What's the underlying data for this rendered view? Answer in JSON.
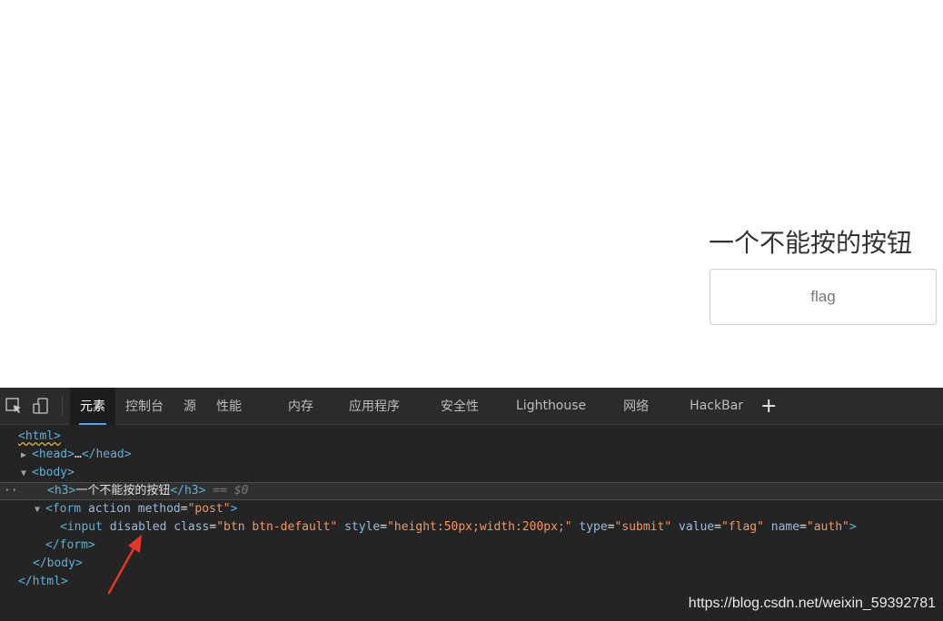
{
  "page": {
    "heading": "一个不能按的按钮",
    "button_value": "flag"
  },
  "devtools": {
    "tabs": [
      "元素",
      "控制台",
      "源",
      "性能",
      "内存",
      "应用程序",
      "安全性",
      "Lighthouse",
      "网络",
      "HackBar"
    ],
    "active_tab": "元素",
    "add_tab": "+",
    "tree": {
      "html_open": "<html>",
      "head_open": "<head>",
      "head_ellipsis": "…",
      "head_close": "</head>",
      "body_open": "<body>",
      "h3_open": "<h3>",
      "h3_text": "一个不能按的按钮",
      "h3_close": "</h3>",
      "selected_marker": "== $0",
      "form_open_tag": "<form",
      "form_attr_action": "action",
      "form_attr_method": "method",
      "form_method_value": "\"post\"",
      "input_open_tag": "<input",
      "input_attr_disabled": "disabled",
      "input_attr_class": "class",
      "input_class_value": "\"btn btn-default\"",
      "input_attr_style": "style",
      "input_style_value": "\"height:50px;width:200px;\"",
      "input_attr_type": "type",
      "input_type_value": "\"submit\"",
      "input_attr_value": "value",
      "input_value_value": "\"flag\"",
      "input_attr_name": "name",
      "input_name_value": "\"auth\"",
      "form_close": "</form>",
      "body_close": "</body>",
      "html_close": "</html>"
    }
  },
  "watermark": "https://blog.csdn.net/weixin_59392781",
  "colors": {
    "devtools_bg": "#242424",
    "tag": "#5db0d7",
    "attr_name": "#9bbbdc",
    "attr_value": "#f29766",
    "active_tab_underline": "#4ea1ff",
    "annotation_arrow": "#e8352a"
  }
}
